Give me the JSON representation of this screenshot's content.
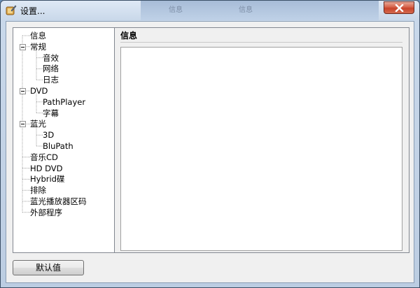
{
  "window": {
    "title": "设置...",
    "backdrop_text": [
      "信息",
      "信息"
    ]
  },
  "tree": {
    "items": [
      {
        "label": "信息",
        "level": 0,
        "expander": false
      },
      {
        "label": "常规",
        "level": 0,
        "expander": true
      },
      {
        "label": "音效",
        "level": 1,
        "expander": false
      },
      {
        "label": "网络",
        "level": 1,
        "expander": false
      },
      {
        "label": "日志",
        "level": 1,
        "expander": false
      },
      {
        "label": "DVD",
        "level": 0,
        "expander": true
      },
      {
        "label": "PathPlayer",
        "level": 1,
        "expander": false
      },
      {
        "label": "字幕",
        "level": 1,
        "expander": false
      },
      {
        "label": "蓝光",
        "level": 0,
        "expander": true
      },
      {
        "label": "3D",
        "level": 1,
        "expander": false
      },
      {
        "label": "BluPath",
        "level": 1,
        "expander": false
      },
      {
        "label": "音乐CD",
        "level": 0,
        "expander": false
      },
      {
        "label": "HD DVD",
        "level": 0,
        "expander": false
      },
      {
        "label": "Hybrid碟",
        "level": 0,
        "expander": false
      },
      {
        "label": "排除",
        "level": 0,
        "expander": false
      },
      {
        "label": "蓝光播放器区码",
        "level": 0,
        "expander": false
      },
      {
        "label": "外部程序",
        "level": 0,
        "expander": false
      }
    ],
    "selected_index": 0
  },
  "content": {
    "heading": "信息",
    "body": ""
  },
  "buttons": {
    "default_label": "默认值"
  },
  "colors": {
    "close_button": "#d5624a",
    "title_bar": "#c9d8ea",
    "dialog_face": "#f0f0f0",
    "tree_line": "#a0a0a0"
  },
  "icons": {
    "app": "settings-app-icon",
    "close": "close-icon",
    "expander": "collapse-minus-icon"
  }
}
